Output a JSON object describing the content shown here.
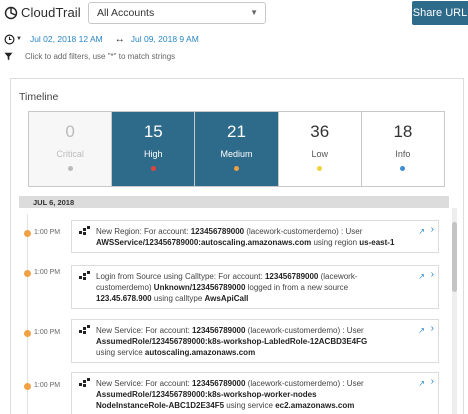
{
  "app": {
    "name": "CloudTrail"
  },
  "header": {
    "account_select": "All Accounts",
    "share_label": "Share URL"
  },
  "time_range": {
    "start": "Jul 02, 2018 12 AM",
    "end": "Jul 09, 2018 9 AM"
  },
  "filter": {
    "hint": "Click to add filters, use \"*\" to match strings"
  },
  "timeline": {
    "title": "Timeline",
    "severities": [
      {
        "count": "0",
        "label": "Critical",
        "dot_color": "#bbbbbb",
        "state": "dim"
      },
      {
        "count": "15",
        "label": "High",
        "dot_color": "#e0443a",
        "state": "active"
      },
      {
        "count": "21",
        "label": "Medium",
        "dot_color": "#f0a144",
        "state": "active"
      },
      {
        "count": "36",
        "label": "Low",
        "dot_color": "#f2d23c",
        "state": "light"
      },
      {
        "count": "18",
        "label": "Info",
        "dot_color": "#3e8ed0",
        "state": "light"
      }
    ],
    "date_header": "JUL 6, 2018",
    "events": [
      {
        "time": "1:00 PM",
        "line1_pre": "New Region: For account: ",
        "line1_bold": "123456789000",
        "line1_post": " (lacework-customerdemo) : User",
        "line2_bold": "AWSService/123456789000:autoscaling.amazonaws.com",
        "line2_post": " using region ",
        "line2_bold2": "us-east-1"
      },
      {
        "time": "1:00 PM",
        "line1_pre": "Login from Source using Calltype: For account: ",
        "line1_bold": "123456789000",
        "line1_post": " (lacework-",
        "line2_pre": "customerdemo) ",
        "line2_bold": "Unknown/123456789000",
        "line2_post": " logged in from a new source",
        "line3_bold": "123.45.678.900",
        "line3_post": " using calltype ",
        "line3_bold2": "AwsApiCall"
      },
      {
        "time": "1:00 PM",
        "line1_pre": "New Service: For account: ",
        "line1_bold": "123456789000",
        "line1_post": " (lacework-customerdemo) : User",
        "line2_bold": "AssumedRole/123456789000:k8s-workshop-LabledRole-12ACBD3E4FG",
        "line3_pre": "using service ",
        "line3_bold": "autoscaling.amazonaws.com"
      },
      {
        "time": "1:00 PM",
        "line1_pre": "New Service: For account: ",
        "line1_bold": "123456789000",
        "line1_post": " (lacework-customerdemo) : User",
        "line2_bold": "AssumedRole/123456789000:k8s-workshop-worker-nodes",
        "line3_bold": "NodeInstanceRole-ABC1D2E34F5",
        "line3_post": " using service ",
        "line3_bold2": "ec2.amazonaws.com"
      }
    ]
  }
}
